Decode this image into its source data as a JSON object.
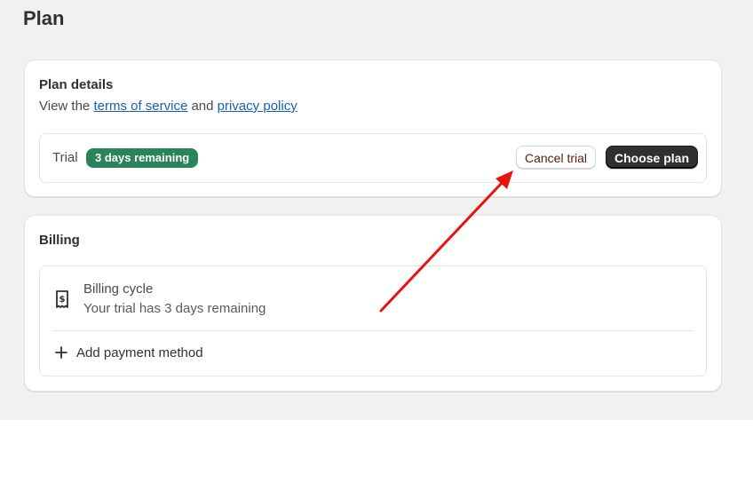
{
  "page": {
    "title": "Plan"
  },
  "plan_details": {
    "title": "Plan details",
    "desc_prefix": "View the",
    "terms_link": "terms of service",
    "desc_and": "and",
    "privacy_link": "privacy policy",
    "trial_label": "Trial",
    "trial_badge": "3 days remaining",
    "cancel_label": "Cancel trial",
    "choose_label": "Choose plan"
  },
  "billing": {
    "title": "Billing",
    "cycle_title": "Billing cycle",
    "cycle_subtitle": "Your trial has 3 days remaining",
    "add_payment_label": "Add payment method"
  },
  "colors": {
    "badge_green": "#29845a",
    "link_blue": "#1a5fb4",
    "annotation_red": "#e8140c",
    "primary_button": "#303030"
  },
  "icons": {
    "billing": "receipt-dollar-icon",
    "add": "plus-icon",
    "annotation": "red-arrow-annotation"
  }
}
